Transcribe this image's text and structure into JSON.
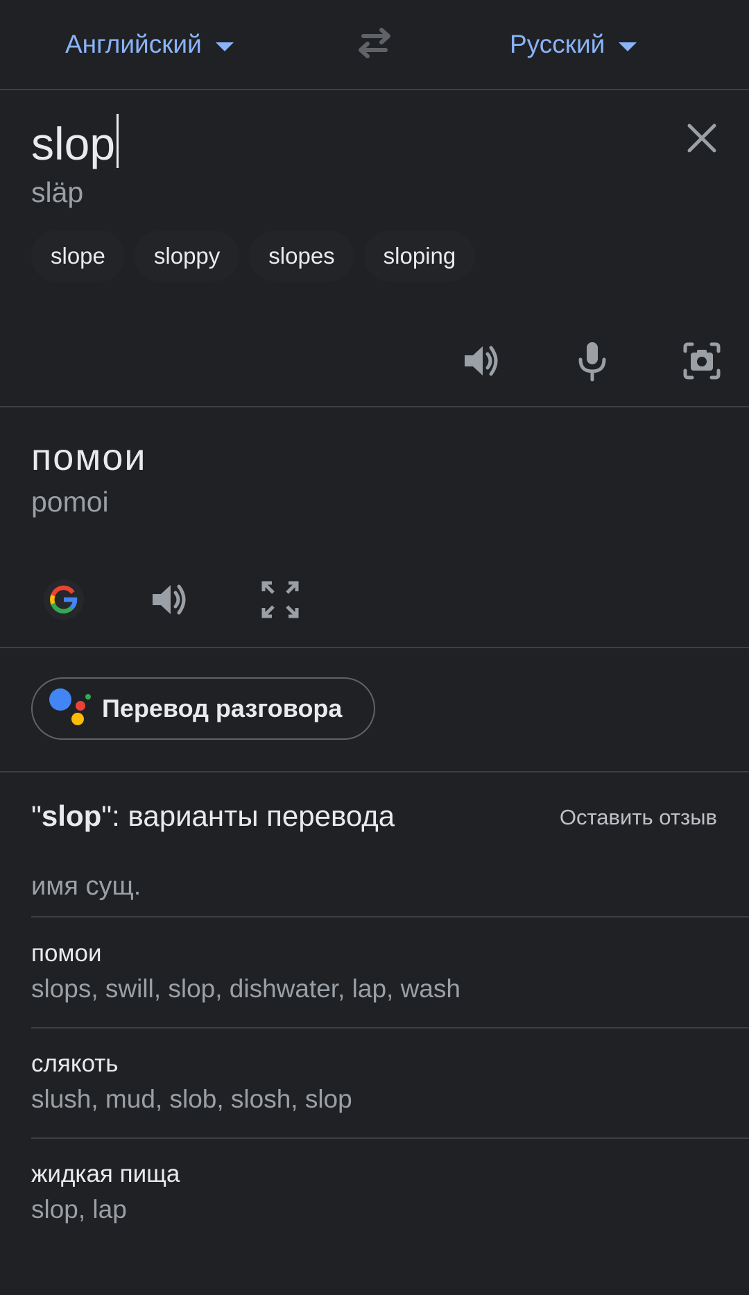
{
  "languages": {
    "source": "Английский",
    "target": "Русский"
  },
  "input": {
    "text": "slop",
    "transliteration": "släp",
    "suggestions": [
      "slope",
      "sloppy",
      "slopes",
      "sloping"
    ]
  },
  "output": {
    "text": "помои",
    "transliteration": "pomoi"
  },
  "conversation": {
    "label": "Перевод разговора"
  },
  "variants": {
    "title_open_quote": "\"",
    "title_word": "slop",
    "title_rest": "\": варианты перевода",
    "feedback": "Оставить отзыв",
    "part_of_speech": "имя сущ.",
    "entries": [
      {
        "word": "помои",
        "synonyms": "slops, swill, slop, dishwater, lap, wash"
      },
      {
        "word": "слякоть",
        "synonyms": "slush, mud, slob, slosh, slop"
      },
      {
        "word": "жидкая пища",
        "synonyms": "slop, lap"
      }
    ]
  },
  "colors": {
    "background": "#202124",
    "accent": "#8ab4f8",
    "text_primary": "#e8eaed",
    "text_secondary": "#9aa0a6",
    "divider": "#3c4043"
  },
  "icons": {
    "swap": "swap-languages-icon",
    "clear": "close-icon",
    "speaker": "speaker-icon",
    "mic": "microphone-icon",
    "camera": "camera-icon",
    "google": "google-g-icon",
    "fullscreen": "fullscreen-icon",
    "assistant": "google-assistant-icon"
  }
}
